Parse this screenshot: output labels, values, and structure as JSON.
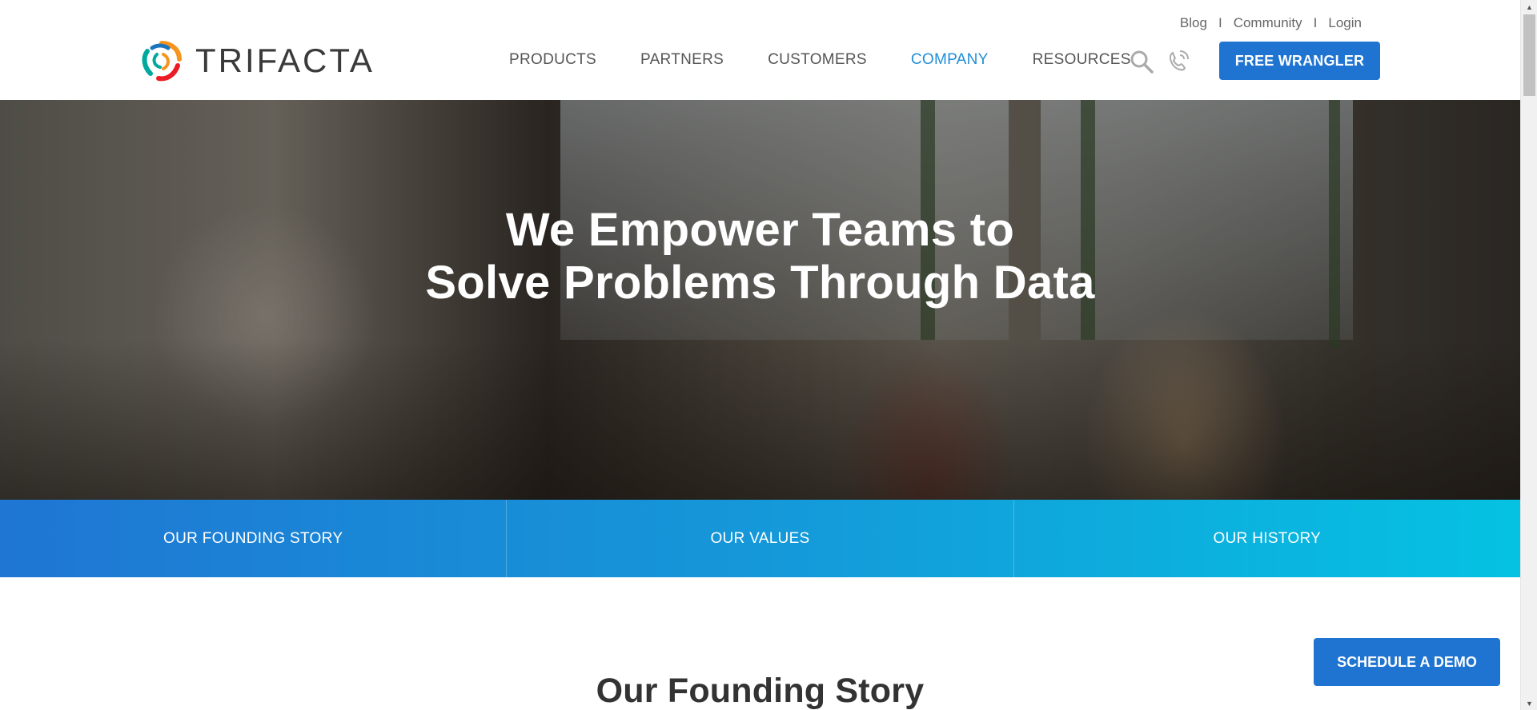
{
  "utility_nav": {
    "blog": "Blog",
    "community": "Community",
    "login": "Login",
    "separator": "I"
  },
  "brand": {
    "name": "TRIFACTA",
    "logo_colors": [
      "#f7941d",
      "#00a99d",
      "#1c75bc",
      "#ec1c24"
    ]
  },
  "main_nav": {
    "items": [
      {
        "label": "PRODUCTS",
        "active": false
      },
      {
        "label": "PARTNERS",
        "active": false
      },
      {
        "label": "CUSTOMERS",
        "active": false
      },
      {
        "label": "COMPANY",
        "active": true
      },
      {
        "label": "RESOURCES",
        "active": false
      }
    ],
    "search_icon": "search-icon",
    "phone_icon": "phone-icon",
    "cta": "FREE WRANGLER"
  },
  "hero": {
    "title_line1": "We Empower Teams to",
    "title_line2": "Solve Problems Through Data"
  },
  "tabs": [
    {
      "label": "OUR FOUNDING STORY"
    },
    {
      "label": "OUR VALUES"
    },
    {
      "label": "OUR HISTORY"
    }
  ],
  "content": {
    "section_title": "Our Founding Story"
  },
  "floating_cta": {
    "label": "SCHEDULE A DEMO"
  },
  "colors": {
    "accent": "#1f73d1",
    "nav_active": "#1f8ed8",
    "tab_gradient_start": "#1f76d3",
    "tab_gradient_end": "#05c2e2"
  }
}
